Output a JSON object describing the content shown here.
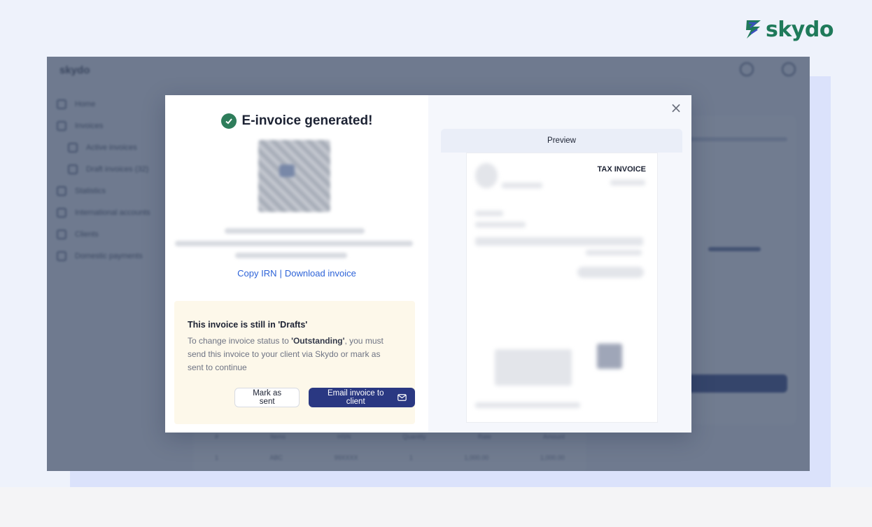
{
  "brand": {
    "logo_text": "skydo",
    "logo_color": "#1f7a5a"
  },
  "app": {
    "name": "skydo",
    "sidebar": {
      "items": [
        {
          "label": "Home",
          "icon": "home-icon",
          "sub": false
        },
        {
          "label": "Invoices",
          "icon": "invoice-icon",
          "sub": false
        },
        {
          "label": "Active invoices",
          "icon": "document-icon",
          "sub": true
        },
        {
          "label": "Draft invoices (32)",
          "icon": "document-icon",
          "sub": true
        },
        {
          "label": "Statistics",
          "icon": "chart-icon",
          "sub": false
        },
        {
          "label": "International accounts",
          "icon": "bank-icon",
          "sub": false
        },
        {
          "label": "Clients",
          "icon": "clients-icon",
          "sub": false
        },
        {
          "label": "Domestic payments",
          "icon": "payments-icon",
          "sub": false
        }
      ]
    },
    "table": {
      "rows": [
        [
          "#",
          "Items",
          "HSN",
          "Quantity",
          "Rate",
          "Amount"
        ],
        [
          "1",
          "ABC",
          "99XXXX",
          "1",
          "1,000.00",
          "1,000.00"
        ]
      ]
    }
  },
  "modal": {
    "title": "E-invoice generated!",
    "copy_irn_label": "Copy IRN",
    "separator": "|",
    "download_label": "Download invoice",
    "draft_notice": {
      "title": "This invoice is still in 'Drafts'",
      "text_before": "To change invoice status to ",
      "status_word": "'Outstanding'",
      "text_after": ", you must send this invoice to your client via Skydo or mark as sent to continue"
    },
    "mark_sent_label": "Mark as sent",
    "email_label": "Email invoice to client",
    "close_symbol": "×",
    "preview": {
      "tab_label": "Preview",
      "doc_heading": "TAX INVOICE"
    }
  },
  "colors": {
    "primary": "#2a3882",
    "link": "#2d63d8",
    "success": "#2e7d5b",
    "notice_bg": "#fdf8ea"
  }
}
